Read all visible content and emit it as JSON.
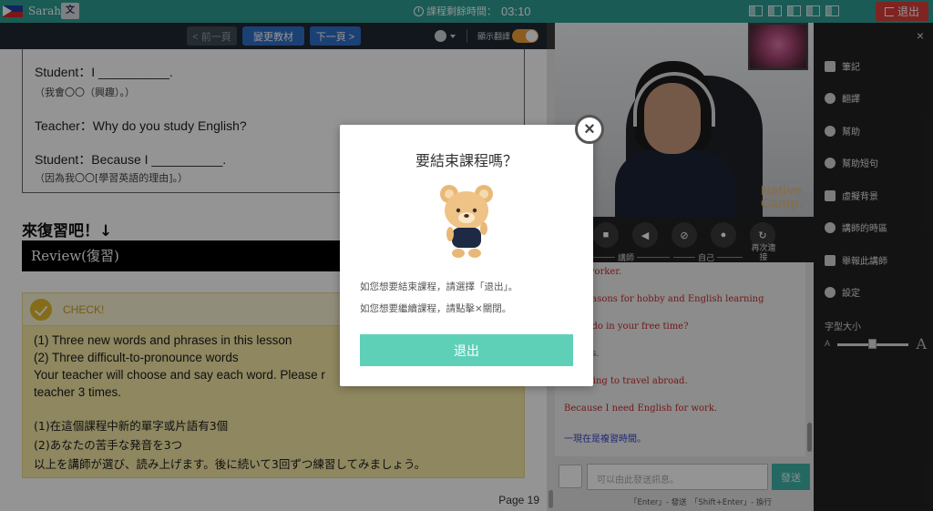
{
  "topbar": {
    "user_name": "Sarah",
    "translate_icon": "translate-icon",
    "timer_label": "課程剩餘時間：",
    "timer_value": "03:10",
    "exit_label": "退出",
    "accent_color": "#2f9e94",
    "exit_color": "#d9403b"
  },
  "toolbar": {
    "prev_label": "< 前一頁",
    "change_label": "變更教材",
    "next_label": "下一頁 >",
    "show_translation_label": "顯示翻譯",
    "show_translation_on": true
  },
  "lesson": {
    "lines": [
      {
        "text": "Student：I __________.",
        "sub": "（我會〇〇（興趣）。）"
      },
      {
        "text": "Teacher：Why do you study English?"
      },
      {
        "text": "Student：Because I __________.",
        "sub": "（因為我〇〇[學習英語的理由]。）"
      }
    ],
    "review_heading": "來復習吧！↓",
    "review_bar": "Review(復習)",
    "check_title": "CHECK!",
    "check_lines": [
      "(1) Three new words and phrases in this lesson",
      "(2) Three difficult-to-pronounce words",
      "Your teacher will choose and say each word. Please r",
      "teacher 3 times."
    ],
    "check_lines_cjk": [
      "(1)在這個課程中新的單字或片語有3個",
      "(2)あなたの苦手な発音を3つ",
      "以上を講師が選び、読み上げます。後に続いて3回ずつ練習してみましょう。"
    ],
    "page_number": "Page 19"
  },
  "video": {
    "watermark": "Native Camp.",
    "teacher_label": "講師",
    "self_label": "自己",
    "reconnect_label": "再次連接"
  },
  "chat": {
    "messages": [
      {
        "text": "ffice worker.",
        "color": "red"
      },
      {
        "text": "the reasons for hobby and English learning",
        "color": "red"
      },
      {
        "text": "o you do in your free time?",
        "color": "red"
      },
      {
        "text": "movies.",
        "color": "red"
      },
      {
        "text": "I'm going to travel abroad.",
        "color": "red"
      },
      {
        "text": "Because I need English for work.",
        "color": "red"
      },
      {
        "text": "一現在是複習時間。",
        "color": "blue"
      }
    ],
    "input_placeholder": "可以由此發送訊息。",
    "send_label": "發送",
    "hint": "「Enter」- 發送　「Shift+Enter」- 換行"
  },
  "sidebar": {
    "items": [
      {
        "label": "筆記",
        "icon": "edit-icon"
      },
      {
        "label": "翻譯",
        "icon": "globe-icon"
      },
      {
        "label": "幫助",
        "icon": "help-icon"
      },
      {
        "label": "幫助短句",
        "icon": "chat-bubble-icon"
      },
      {
        "label": "虛擬背景",
        "icon": "image-icon"
      },
      {
        "label": "講師的時區",
        "icon": "world-icon"
      },
      {
        "label": "舉報此講師",
        "icon": "flag-icon"
      },
      {
        "label": "設定",
        "icon": "gear-icon"
      }
    ],
    "font_size_label": "字型大小",
    "font_small": "A",
    "font_large": "A",
    "font_size_level": 0.5
  },
  "modal": {
    "title": "要結束課程嗎？",
    "text1": "如您想要結束課程，請選擇「退出」。",
    "text2": "如您想要繼續課程，請點擊×關閉。",
    "exit_label": "退出",
    "exit_color": "#5fd0b8"
  }
}
